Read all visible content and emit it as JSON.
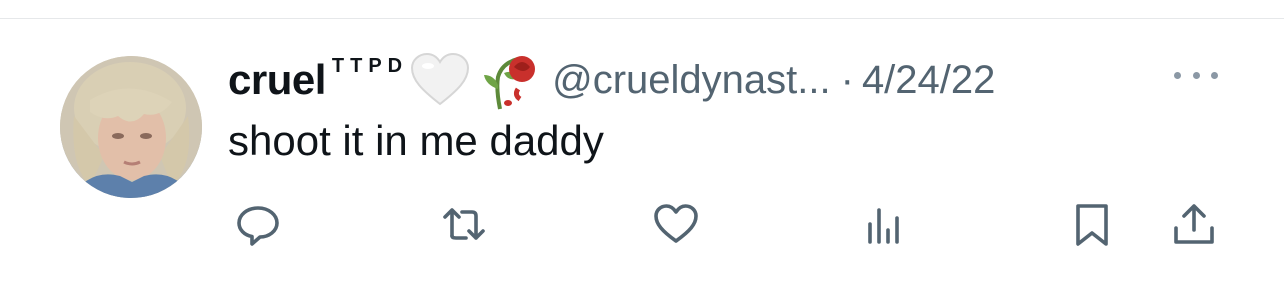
{
  "tweet": {
    "display_name": "cruel",
    "name_superscript": "TTPD",
    "name_emojis": [
      "white-heart",
      "wilted-rose"
    ],
    "handle": "@crueldynast...",
    "separator": "·",
    "date": "4/24/22",
    "text": "shoot it in me daddy"
  },
  "actions": [
    {
      "name": "reply",
      "icon": "speech-bubble-icon"
    },
    {
      "name": "retweet",
      "icon": "retweet-icon"
    },
    {
      "name": "like",
      "icon": "heart-icon"
    },
    {
      "name": "views",
      "icon": "bar-chart-icon"
    },
    {
      "name": "bookmark",
      "icon": "bookmark-icon"
    },
    {
      "name": "share",
      "icon": "share-icon"
    }
  ],
  "colors": {
    "text_primary": "#0f1419",
    "text_secondary": "#536471",
    "divider": "#e6e8ea"
  }
}
